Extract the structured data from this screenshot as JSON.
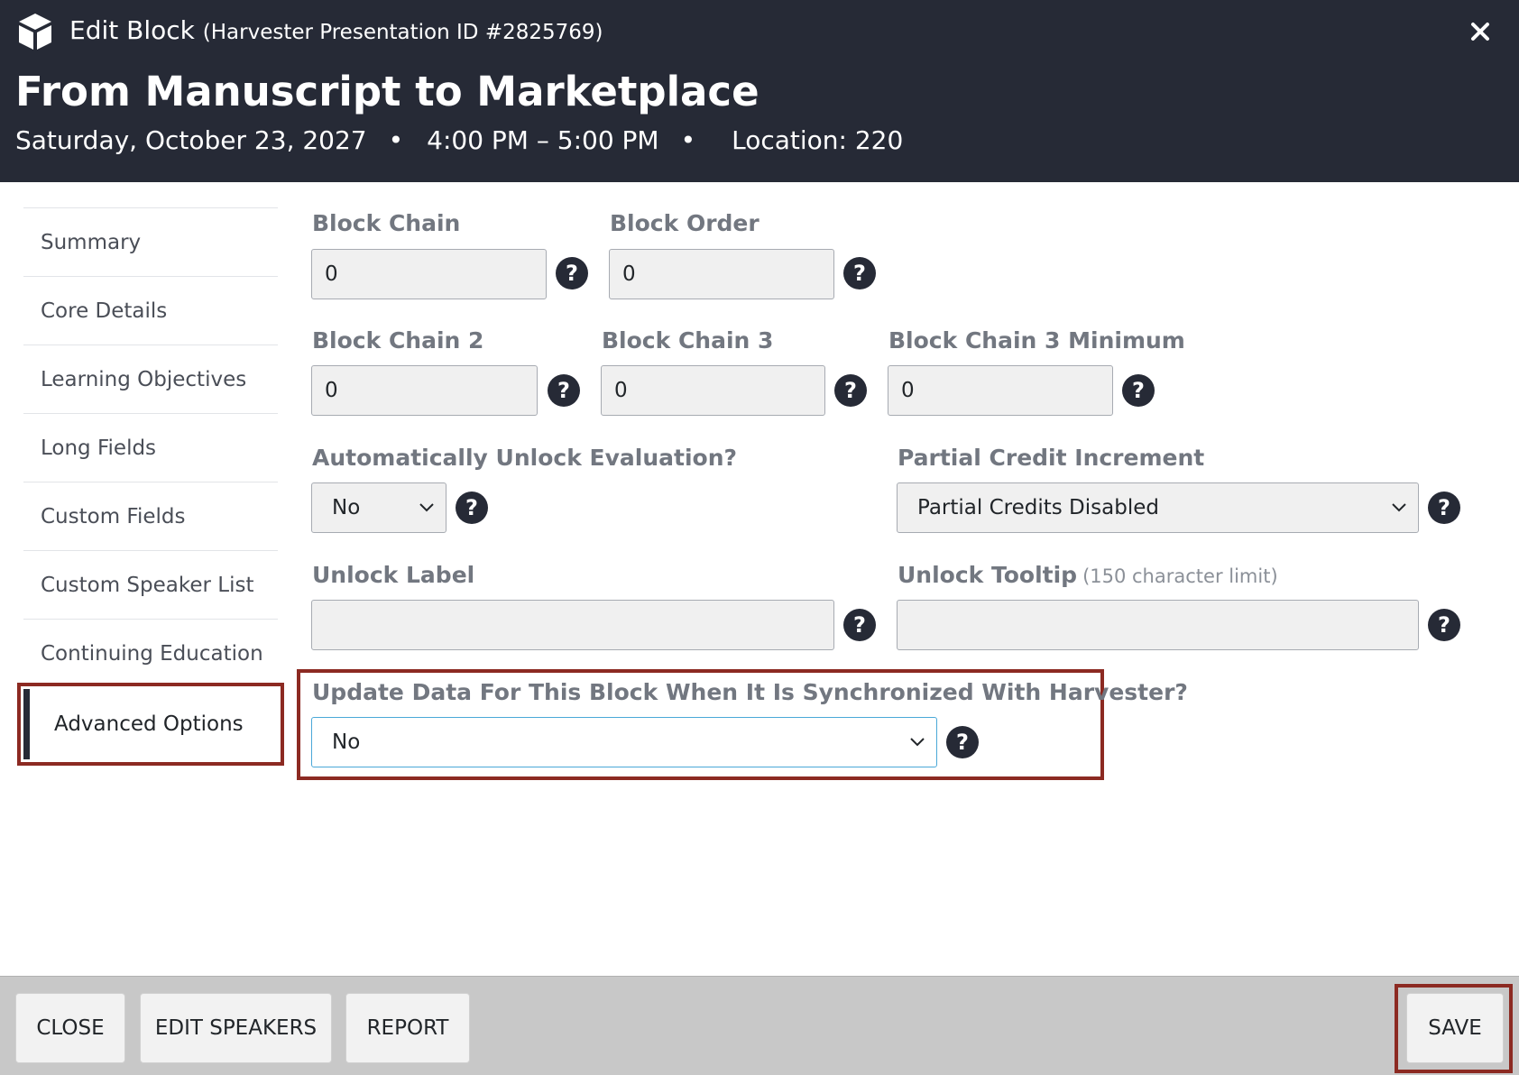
{
  "header": {
    "dialog_title": "Edit Block",
    "dialog_subtitle": "(Harvester Presentation ID #2825769)",
    "session_title": "From Manuscript to Marketplace",
    "date": "Saturday, October 23, 2027",
    "separator": "•",
    "time": "4:00 PM – 5:00 PM",
    "location": "Location: 220",
    "close_icon": "close-icon",
    "logo_icon": "cube-icon"
  },
  "sidebar": {
    "items": [
      {
        "label": "Summary"
      },
      {
        "label": "Core Details"
      },
      {
        "label": "Learning Objectives"
      },
      {
        "label": "Long Fields"
      },
      {
        "label": "Custom Fields"
      },
      {
        "label": "Custom Speaker List"
      },
      {
        "label": "Continuing Education"
      },
      {
        "label": "Advanced Options",
        "active": true
      }
    ]
  },
  "form": {
    "block_chain": {
      "label": "Block Chain",
      "value": "0"
    },
    "block_order": {
      "label": "Block Order",
      "value": "0"
    },
    "block_chain_2": {
      "label": "Block Chain 2",
      "value": "0"
    },
    "block_chain_3": {
      "label": "Block Chain 3",
      "value": "0"
    },
    "block_chain_3_min": {
      "label": "Block Chain 3 Minimum",
      "value": "0"
    },
    "auto_unlock": {
      "label": "Automatically Unlock Evaluation?",
      "value": "No"
    },
    "partial_credit": {
      "label": "Partial Credit Increment",
      "value": "Partial Credits Disabled"
    },
    "unlock_label": {
      "label": "Unlock Label",
      "value": ""
    },
    "unlock_tooltip": {
      "label": "Unlock Tooltip",
      "hint": "(150 character limit)",
      "value": ""
    },
    "sync_update": {
      "label": "Update Data For This Block When It Is Synchronized With Harvester?",
      "value": "No"
    },
    "help_glyph": "?"
  },
  "footer": {
    "close_label": "CLOSE",
    "edit_speakers_label": "EDIT SPEAKERS",
    "report_label": "REPORT",
    "save_label": "SAVE"
  },
  "colors": {
    "header_bg": "#262a36",
    "highlight": "#8c2a22",
    "footer_bg": "#c8c8c8",
    "active_select_border": "#4aa8d8"
  }
}
